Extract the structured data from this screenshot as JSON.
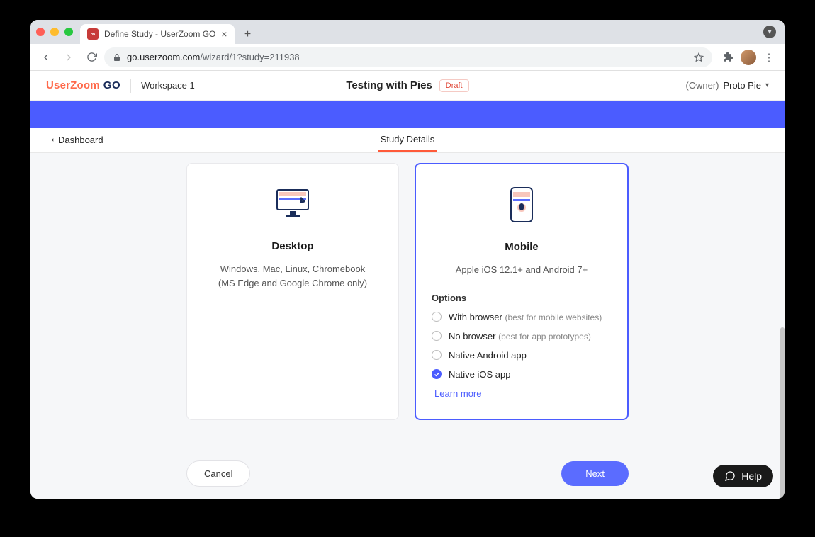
{
  "browser": {
    "tab_title": "Define Study - UserZoom GO",
    "url_host": "go.userzoom.com",
    "url_path": "/wizard/1?study=211938"
  },
  "appbar": {
    "logo_main": "UserZoom",
    "logo_go": "GO",
    "workspace": "Workspace 1",
    "study_title": "Testing with Pies",
    "badge": "Draft",
    "owner_prefix": "(Owner)",
    "owner_name": "Proto Pie"
  },
  "subnav": {
    "back": "Dashboard",
    "tab": "Study Details"
  },
  "cards": {
    "desktop": {
      "title": "Desktop",
      "line1": "Windows, Mac, Linux, Chromebook",
      "line2": "(MS Edge and Google Chrome only)"
    },
    "mobile": {
      "title": "Mobile",
      "desc": "Apple iOS 12.1+ and Android 7+",
      "options_head": "Options",
      "opt1_label": "With browser",
      "opt1_hint": "(best for mobile websites)",
      "opt2_label": "No browser",
      "opt2_hint": "(best for app prototypes)",
      "opt3_label": "Native Android app",
      "opt4_label": "Native iOS app",
      "learn_more": "Learn more"
    }
  },
  "footer": {
    "cancel": "Cancel",
    "next": "Next"
  },
  "help": {
    "label": "Help"
  }
}
